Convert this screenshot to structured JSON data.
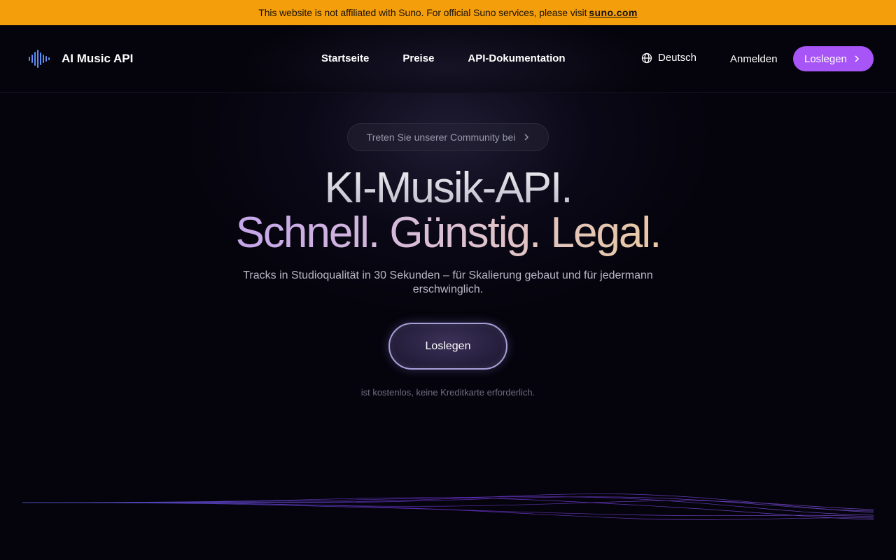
{
  "banner": {
    "text": "This website is not affiliated with Suno. For official Suno services, please visit",
    "link": "suno.com",
    "color": "#f59e0b"
  },
  "header": {
    "logo_icon": "waveform-logo-icon",
    "brand": "AI Music API",
    "nav": [
      {
        "label": "Startseite"
      },
      {
        "label": "Preise"
      },
      {
        "label": "API-Dokumentation"
      }
    ],
    "language": {
      "icon": "globe-icon",
      "label": "Deutsch"
    },
    "login": "Anmelden",
    "cta": {
      "label": "Loslegen",
      "icon": "chevron-right-icon",
      "color": "#a855f7"
    }
  },
  "hero": {
    "community_pill": {
      "label": "Treten Sie unserer Community bei",
      "icon": "chevron-right-icon"
    },
    "title_line1": "KI-Musik-API.",
    "title_line2": "Schnell. Günstig. Legal.",
    "subtitle": "Tracks in Studioqualität in 30 Sekunden – für Skalierung gebaut und für jedermann erschwinglich.",
    "cta": "Loslegen",
    "note": "ist kostenlos, keine Kreditkarte erforderlich."
  }
}
